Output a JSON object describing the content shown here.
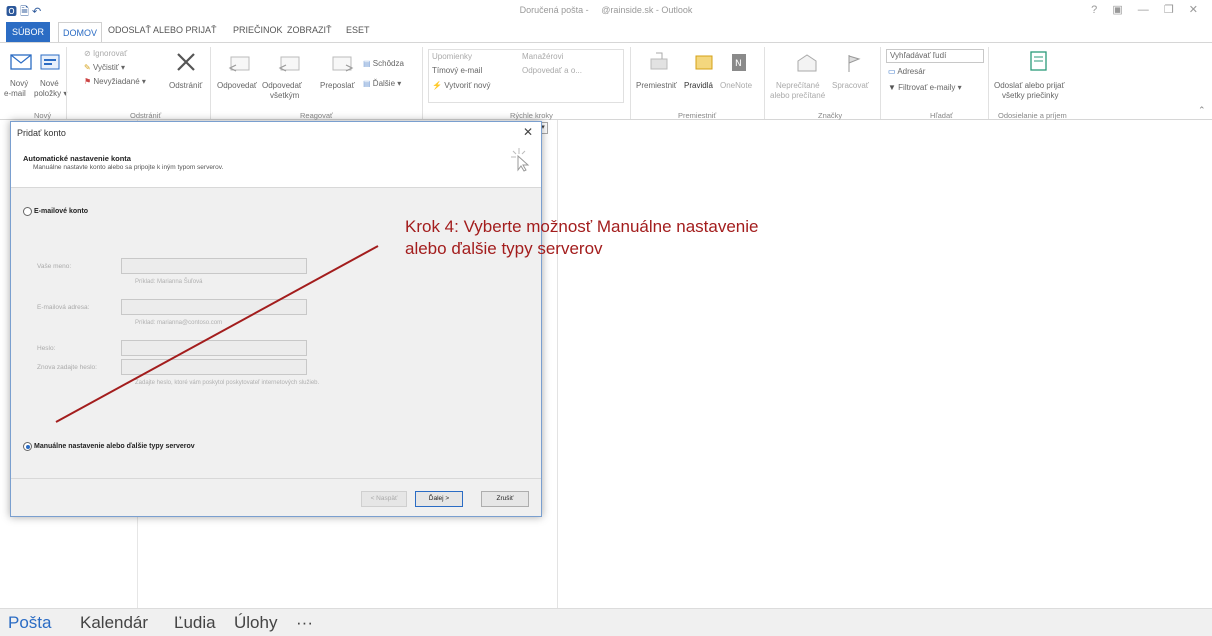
{
  "window": {
    "title": "Doručená pošta -",
    "account_title": "@rainside.sk - Outlook",
    "controls": [
      "?",
      "▣",
      "—",
      "❐",
      "✕"
    ]
  },
  "tabs": [
    "SÚBOR",
    "DOMOV",
    "ODOSLAŤ ALEBO PRIJAŤ",
    "PRIEČINOK",
    "ZOBRAZIŤ",
    "ESET"
  ],
  "ribbon": {
    "new_mail": [
      "Nový",
      "e-mail"
    ],
    "new_items": [
      "Nové",
      "položky ▾"
    ],
    "group_new": "Nový",
    "ignore": "Ignorovať",
    "cleanup": "Vyčistiť ▾",
    "junk": "Nevyžiadané ▾",
    "delete": "Odstrániť",
    "group_delete": "Odstrániť",
    "reply": "Odpovedať",
    "reply_all": [
      "Odpovedať",
      "všetkým"
    ],
    "forward": "Preposlať",
    "meeting": "Schôdza",
    "more": "Ďalšie ▾",
    "group_respond": "Reagovať",
    "quick1": "Upomienky",
    "quick2": "Manažérovi",
    "quick3": "Tímový e-mail",
    "quick4": "Odpovedať a o...",
    "quick5": "Vytvoriť nový",
    "group_quick": "Rýchle kroky",
    "move": "Premiestniť",
    "rules": "Pravidlá",
    "onenote": "OneNote",
    "group_move": "Premiestniť",
    "unread": [
      "Neprečítané",
      "alebo prečítané"
    ],
    "followup": "Spracovať",
    "group_tags": "Značky",
    "search_people": "Vyhľadávať ľudí",
    "address_book": "Adresár",
    "filter_email": "Filtrovať e-maily ▾",
    "group_find": "Hľadať",
    "send_receive": [
      "Odoslať alebo prijať",
      "všetky priečinky"
    ],
    "group_send": "Odosielanie a príjem"
  },
  "dialog": {
    "title": "Pridať konto",
    "close": "✕",
    "heading": "Automatické nastavenie konta",
    "subheading": "Manuálne nastavte konto alebo sa pripojte k iným typom serverov.",
    "email_account": "E-mailové konto",
    "name_label": "Vaše meno:",
    "name_hint": "Príklad: Marianna Šuľová",
    "email_label": "E-mailová adresa:",
    "email_hint": "Príklad: marianna@contoso.com",
    "password_label": "Heslo:",
    "retype_label": "Znova zadajte heslo:",
    "password_hint": "Zadajte heslo, ktoré vám poskytol poskytovateľ internetových služieb.",
    "manual_option": "Manuálne nastavenie alebo ďalšie typy serverov",
    "back": "< Naspäť",
    "next": "Ďalej >",
    "cancel": "Zrušiť"
  },
  "annotation": {
    "line1": "Krok 4: Vyberte možnosť Manuálne nastavenie",
    "line2": "alebo ďalšie typy serverov",
    "color": "#a31d1d"
  },
  "bottom_nav": [
    "Pošta",
    "Kalendár",
    "Ľudia",
    "Úlohy",
    "···"
  ],
  "accent": "#2b6cc4"
}
